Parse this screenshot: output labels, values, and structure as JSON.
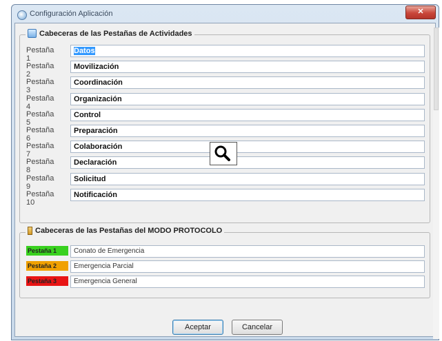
{
  "window": {
    "title": "Configuración Aplicación",
    "close_label": "✕"
  },
  "group1": {
    "legend": "Cabeceras de las Pestañas de Actividades",
    "rows": [
      {
        "label": "Pestaña 1",
        "value": "Datos"
      },
      {
        "label": "Pestaña 2",
        "value": "Movilización"
      },
      {
        "label": "Pestaña 3",
        "value": "Coordinación"
      },
      {
        "label": "Pestaña 4",
        "value": "Organización"
      },
      {
        "label": "Pestaña 5",
        "value": "Control"
      },
      {
        "label": "Pestaña 6",
        "value": "Preparación"
      },
      {
        "label": "Pestaña 7",
        "value": "Colaboración"
      },
      {
        "label": "Pestaña 8",
        "value": "Declaración"
      },
      {
        "label": "Pestaña 9",
        "value": "Solicitud"
      },
      {
        "label": "Pestaña 10",
        "value": "Notificación"
      }
    ]
  },
  "group2": {
    "legend": "Cabeceras de las Pestañas del MODO PROTOCOLO",
    "rows": [
      {
        "label": "Pestaña 1",
        "value": "Conato de Emergencia",
        "color": "#39d11f"
      },
      {
        "label": "Pestaña 2",
        "value": "Emergencia Parcial",
        "color": "#f0a000"
      },
      {
        "label": "Pestaña 3",
        "value": "Emergencia General",
        "color": "#e81414"
      }
    ]
  },
  "buttons": {
    "accept": "Aceptar",
    "cancel": "Cancelar"
  }
}
